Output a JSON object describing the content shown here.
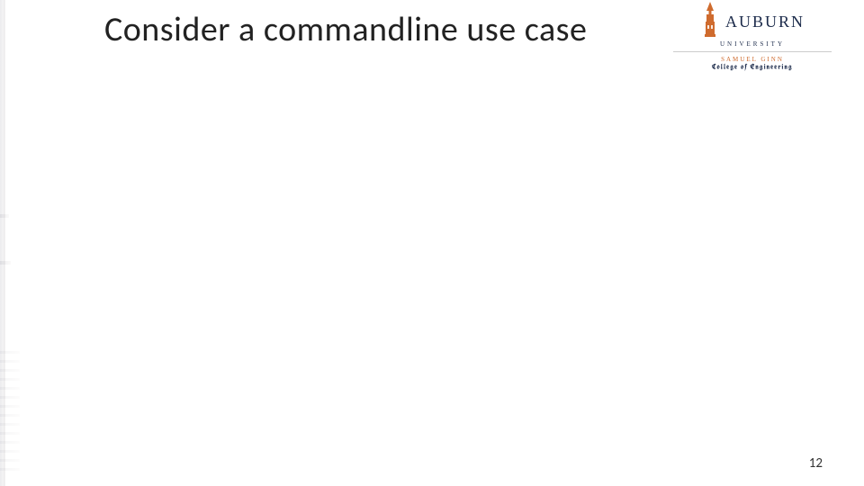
{
  "slide": {
    "title": "Consider a commandline use case",
    "page_number": "12"
  },
  "logo": {
    "brand": "AUBURN",
    "subbrand": "UNIVERSITY",
    "college_line1": "SAMUEL GINN",
    "college_line2": "College of Engineering"
  },
  "colors": {
    "auburn_orange": "#cf6b2e",
    "auburn_navy": "#1b2a4a"
  }
}
